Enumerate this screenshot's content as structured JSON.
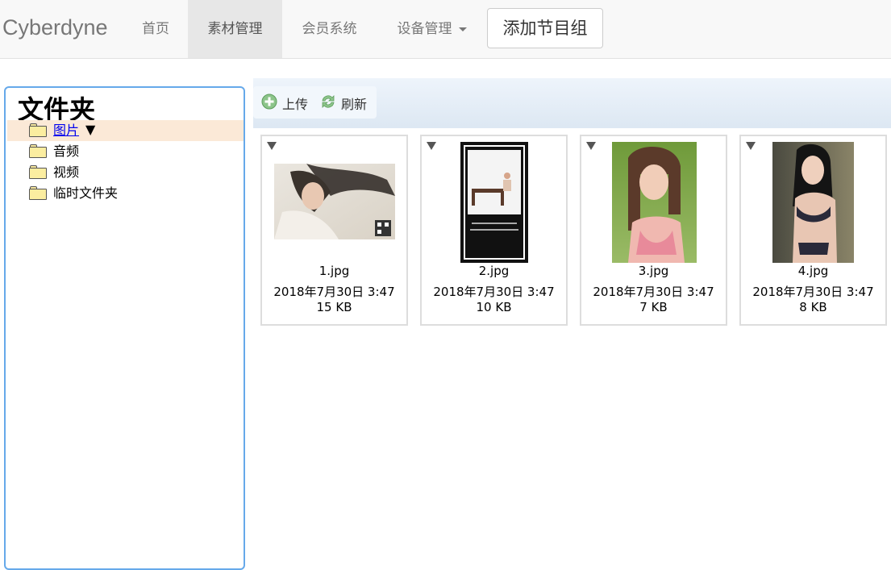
{
  "navbar": {
    "brand": "Cyberdyne",
    "items": [
      {
        "label": "首页"
      },
      {
        "label": "素材管理"
      },
      {
        "label": "会员系统"
      },
      {
        "label": "设备管理"
      }
    ],
    "add_button": "添加节目组"
  },
  "folders": {
    "title": "文件夹",
    "items": [
      {
        "label": "图片",
        "selected": true,
        "expand_marker": "▼"
      },
      {
        "label": "音频"
      },
      {
        "label": "视频"
      },
      {
        "label": "临时文件夹"
      }
    ]
  },
  "toolbar": {
    "upload_label": "上传",
    "refresh_label": "刷新"
  },
  "files": [
    {
      "name": "1.jpg",
      "date": "2018年7月30日 3:47",
      "size": "15 KB"
    },
    {
      "name": "2.jpg",
      "date": "2018年7月30日 3:47",
      "size": "10 KB"
    },
    {
      "name": "3.jpg",
      "date": "2018年7月30日 3:47",
      "size": "7 KB"
    },
    {
      "name": "4.jpg",
      "date": "2018年7月30日 3:47",
      "size": "8 KB"
    }
  ],
  "colors": {
    "panel_border": "#66a9ea",
    "selected_row": "#fbe9d7",
    "active_nav": "#e7e7e7"
  }
}
